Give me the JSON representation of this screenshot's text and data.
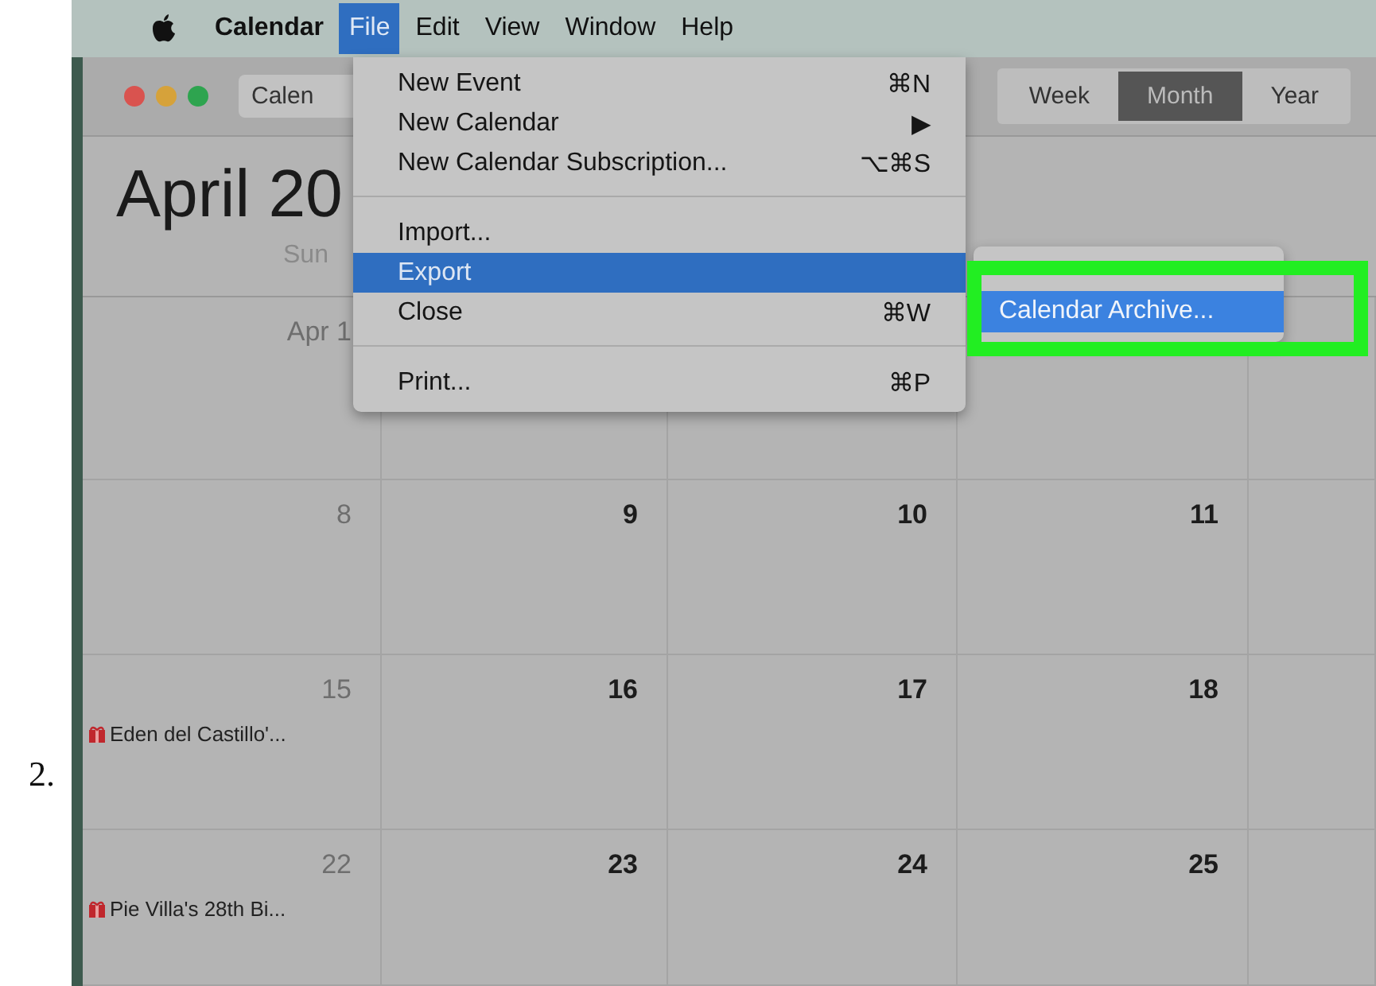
{
  "step_number": "2.",
  "menu_bar": {
    "app": "Calendar",
    "menus": [
      {
        "label": "File",
        "selected": true
      },
      {
        "label": "Edit",
        "selected": false
      },
      {
        "label": "View",
        "selected": false
      },
      {
        "label": "Window",
        "selected": false
      },
      {
        "label": "Help",
        "selected": false
      }
    ]
  },
  "toolbar": {
    "calendars_button": "Calen",
    "views": [
      {
        "label": "Week",
        "selected": false
      },
      {
        "label": "Month",
        "selected": true
      },
      {
        "label": "Year",
        "selected": false
      }
    ]
  },
  "header": {
    "title": "April 20",
    "weekday": "Sun"
  },
  "calendar": {
    "weeks": [
      {
        "cells": [
          {
            "date": "Apr 1",
            "dimmed": true
          },
          {},
          {},
          {},
          {}
        ]
      },
      {
        "cells": [
          {
            "date": "8",
            "dimmed": true
          },
          {
            "date": "9",
            "dimmed": false
          },
          {
            "date": "10",
            "dimmed": false
          },
          {
            "date": "11",
            "dimmed": false
          },
          {}
        ]
      },
      {
        "cells": [
          {
            "date": "15",
            "dimmed": true,
            "events": [
              "Eden del Castillo'..."
            ]
          },
          {
            "date": "16",
            "dimmed": false
          },
          {
            "date": "17",
            "dimmed": false
          },
          {
            "date": "18",
            "dimmed": false
          },
          {}
        ]
      },
      {
        "cells": [
          {
            "date": "22",
            "dimmed": true,
            "events": [
              "Pie Villa's 28th Bi..."
            ]
          },
          {
            "date": "23",
            "dimmed": false
          },
          {
            "date": "24",
            "dimmed": false
          },
          {
            "date": "25",
            "dimmed": false
          },
          {}
        ]
      }
    ]
  },
  "file_menu": {
    "items": [
      {
        "kind": "item",
        "label": "New Event",
        "shortcut": "⌘N",
        "selected": false
      },
      {
        "kind": "item",
        "label": "New Calendar",
        "shortcut": "▶",
        "selected": false
      },
      {
        "kind": "item",
        "label": "New Calendar Subscription...",
        "shortcut": "⌥⌘S",
        "selected": false
      },
      {
        "kind": "separator"
      },
      {
        "kind": "item",
        "label": "Import...",
        "selected": false
      },
      {
        "kind": "item",
        "label": "Export",
        "selected": true
      },
      {
        "kind": "item",
        "label": "Close",
        "shortcut": "⌘W",
        "selected": false
      },
      {
        "kind": "separator"
      },
      {
        "kind": "item",
        "label": "Print...",
        "shortcut": "⌘P",
        "selected": false
      }
    ]
  },
  "submenu": {
    "items": [
      {
        "label": "Calendar Archive...",
        "selected": true
      }
    ]
  }
}
